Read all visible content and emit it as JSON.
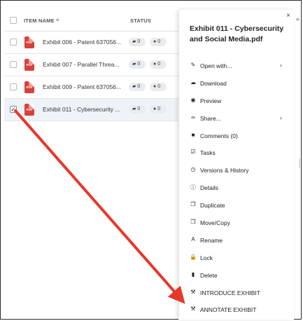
{
  "list": {
    "header": {
      "name_label": "ITEM NAME ^",
      "status_label": "STATUS"
    },
    "rows": [
      {
        "icon_text": "PDF",
        "name": "Exhibit 006 - Patent 637056...",
        "comments": "0",
        "views": "0",
        "checked": false
      },
      {
        "icon_text": "PDF",
        "name": "Exhibit 007 - Parallel Threa...",
        "comments": "0",
        "views": "0",
        "checked": false
      },
      {
        "icon_text": "PDF",
        "name": "Exhibit 009 - Patent 637056...",
        "comments": "0",
        "views": "0",
        "checked": false
      },
      {
        "icon_text": "PDF",
        "name": "Exhibit 011 - Cybersecurity ...",
        "comments": "0",
        "views": "0",
        "checked": true
      }
    ]
  },
  "panel": {
    "close": "×",
    "collapse": "«",
    "title": "Exhibit 011 - Cybersecurity and Social Media.pdf",
    "items": [
      {
        "icon": "pencil-icon",
        "glyph": "✎",
        "label": "Open with...",
        "chevron": "›"
      },
      {
        "icon": "cloud-download-icon",
        "glyph": "☁",
        "label": "Download"
      },
      {
        "icon": "eye-icon",
        "glyph": "◉",
        "label": "Preview"
      },
      {
        "icon": "share-link-icon",
        "glyph": "∞",
        "label": "Share...",
        "chevron": "›"
      },
      {
        "icon": "comment-icon",
        "glyph": "■",
        "label": "Comments (0)"
      },
      {
        "icon": "tasks-icon",
        "glyph": "☑",
        "label": "Tasks"
      },
      {
        "icon": "history-clock-icon",
        "glyph": "◷",
        "label": "Versions & History"
      },
      {
        "icon": "info-icon",
        "glyph": "ⓘ",
        "label": "Details"
      },
      {
        "icon": "duplicate-icon",
        "glyph": "❐",
        "label": "Duplicate"
      },
      {
        "icon": "move-copy-icon",
        "glyph": "❐",
        "label": "Move/Copy"
      },
      {
        "icon": "rename-icon",
        "glyph": "A",
        "label": "Rename"
      },
      {
        "icon": "lock-icon",
        "glyph": "🔒",
        "label": "Lock"
      },
      {
        "icon": "trash-icon",
        "glyph": "▮",
        "label": "Delete"
      },
      {
        "icon": "gavel-icon",
        "glyph": "⚒",
        "label": "INTRODUCE EXHIBIT"
      },
      {
        "icon": "gavel-icon",
        "glyph": "⚒",
        "label": "ANNOTATE EXHIBIT"
      }
    ]
  },
  "colors": {
    "arrow": "#e8362b",
    "pdf": "#d9413b",
    "selected_row": "#eef3f8"
  }
}
